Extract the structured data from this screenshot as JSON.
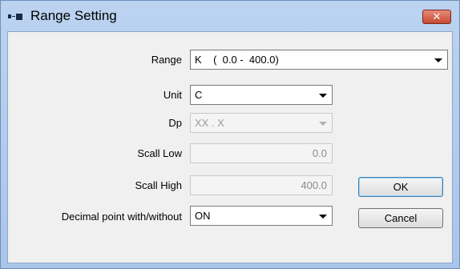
{
  "window": {
    "title": "Range Setting",
    "close_symbol": "✕"
  },
  "form": {
    "range": {
      "label": "Range",
      "value": "K    (  0.0 -  400.0)"
    },
    "unit": {
      "label": "Unit",
      "value": "C"
    },
    "dp": {
      "label": "Dp",
      "value": "XX . X"
    },
    "scall_low": {
      "label": "Scall Low",
      "value": "0.0"
    },
    "scall_high": {
      "label": "Scall High",
      "value": "400.0"
    },
    "decimal_point": {
      "label": "Decimal point with/without",
      "value": "ON"
    }
  },
  "buttons": {
    "ok": "OK",
    "cancel": "Cancel"
  },
  "icons": {
    "app": "dialog-icon",
    "close": "close-icon"
  },
  "colors": {
    "titlebar": "#bcd3f0",
    "close_button": "#c74a34",
    "client_bg": "#f0f0f0"
  }
}
